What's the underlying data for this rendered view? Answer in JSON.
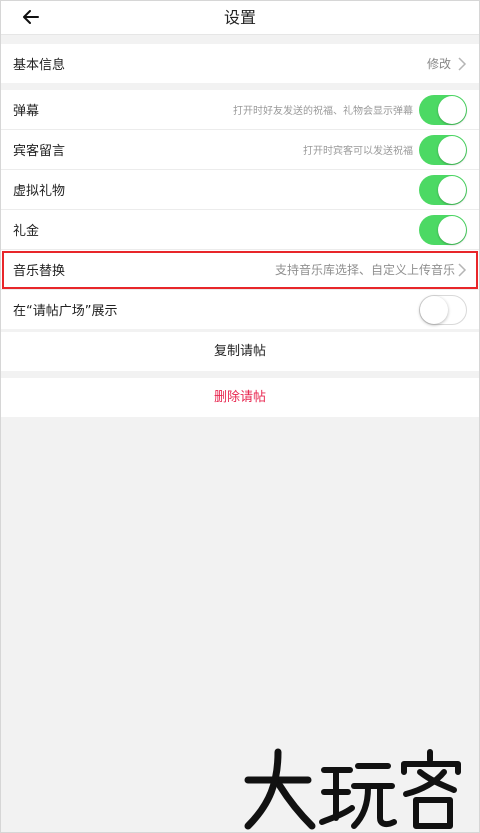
{
  "header": {
    "title": "设置",
    "back_icon": "arrow-left-icon"
  },
  "basic_info": {
    "label": "基本信息",
    "action": "修改"
  },
  "settings": [
    {
      "label": "弹幕",
      "desc": "打开时好友发送的祝福、礼物会显示弹幕",
      "toggle": true
    },
    {
      "label": "宾客留言",
      "desc": "打开时宾客可以发送祝福",
      "toggle": true
    },
    {
      "label": "虚拟礼物",
      "desc": "",
      "toggle": true
    },
    {
      "label": "礼金",
      "desc": "",
      "toggle": true
    },
    {
      "label": "音乐替换",
      "desc": "支持音乐库选择、自定义上传音乐",
      "chevron": true
    },
    {
      "label": "在“请帖广场”展示",
      "desc": "",
      "toggle": false
    }
  ],
  "actions": {
    "copy": "复制请帖",
    "delete": "删除请帖"
  },
  "watermark": {
    "text": "大玩客"
  },
  "colors": {
    "toggle_on": "#4cd964",
    "delete_text": "#e8264f",
    "highlight_border": "#e8262a"
  }
}
